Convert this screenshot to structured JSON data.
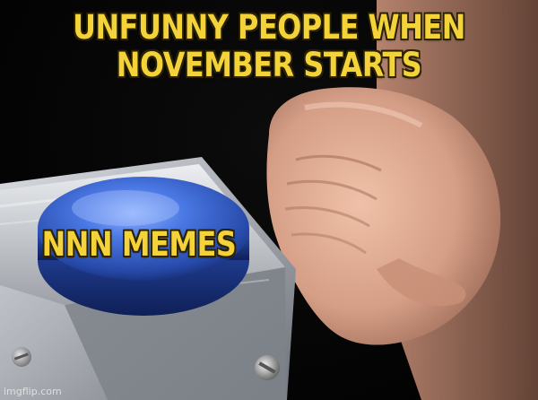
{
  "meme": {
    "template": "Blank Nut Button",
    "caption_top_lines": [
      "UNFUNNY PEOPLE WHEN",
      "NOVEMBER STARTS"
    ],
    "caption_button": "NNN MEMES",
    "watermark": "imgflip.com",
    "colors": {
      "caption": "#f4d33a",
      "caption_outline": "#2a2200",
      "background": "#000000",
      "button_blue": "#3f6ad8",
      "housing_grey": "#b8bcc2",
      "skin": "#d9a48a"
    },
    "icons": {
      "button": "push-button-icon",
      "hand": "slapping-hand-icon"
    }
  }
}
